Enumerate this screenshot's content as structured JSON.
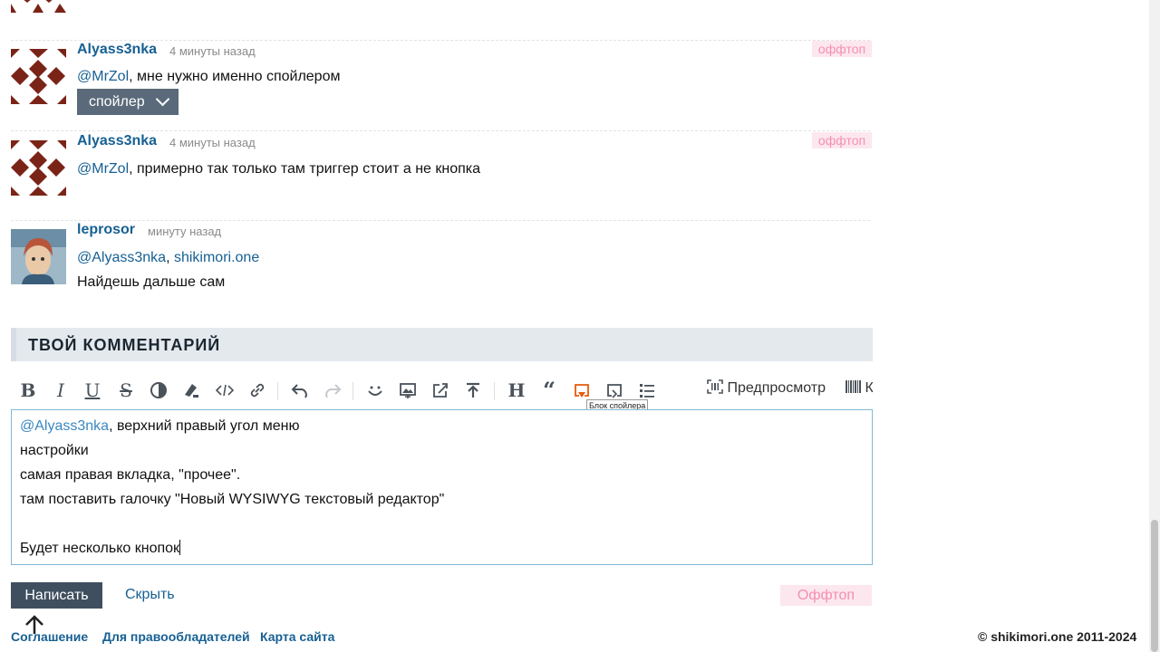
{
  "comments": [
    {
      "author": "Alyass3nka",
      "time": "4 минуты назад",
      "tag": "оффтоп",
      "mention": "@MrZol",
      "text": ", мне нужно именно спойлером",
      "spoiler_label": "спойлер"
    },
    {
      "author": "Alyass3nka",
      "time": "4 минуты назад",
      "tag": "оффтоп",
      "mention": "@MrZol",
      "text": ", примерно так только там триггер стоит а не кнопка"
    },
    {
      "author": "leprosor",
      "time": "минуту назад",
      "mention": "@Alyass3nka",
      "separator": ", ",
      "link": "shikimori.one",
      "text2": "Найдешь дальше сам"
    }
  ],
  "section_title": "ТВОЙ КОММЕНТАРИЙ",
  "toolbar": {
    "preview_label": "Предпросмотр",
    "more_label": "К",
    "tooltip": "Блок спойлера"
  },
  "editor": {
    "mention": "@Alyass3nka",
    "line1_rest": ", верхний правый угол меню",
    "line2": "настройки",
    "line3": "самая правая вкладка, \"прочее\".",
    "line4": "там поставить галочку \"Новый WYSIWYG текстовый редактор\"",
    "line6": "Будет несколько кнопок"
  },
  "form": {
    "submit_label": "Написать",
    "hide_label": "Скрыть",
    "offtop_label": "Оффтоп"
  },
  "footer": {
    "links": [
      "Соглашение",
      "Для правообладателей",
      "Карта сайта"
    ],
    "copyright": "© shikimori.one 2011-2024"
  },
  "colors": {
    "link": "#176093",
    "offtopic_bg": "#fde7ef",
    "offtopic_text": "#f48fb1",
    "submit_bg": "#3f4f5f",
    "spoiler_icon_active": "#e8590c"
  }
}
